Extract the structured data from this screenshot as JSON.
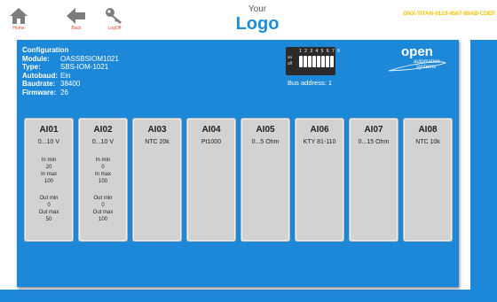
{
  "header": {
    "home_label": "Home",
    "back_label": "Back",
    "logoff_label": "LogOff",
    "logo_small": "Your",
    "logo_big": "Logo",
    "serial": "GNX-TITAN-0123-4567-89AB-CDEF"
  },
  "config": {
    "title": "Configuration",
    "rows": [
      {
        "key": "Module:",
        "value": "OASSBSIOM1021"
      },
      {
        "key": "Type:",
        "value": "SBS-IOM-1021"
      },
      {
        "key": "Autobaud:",
        "value": "Ein"
      },
      {
        "key": "Baudrate:",
        "value": "38400"
      },
      {
        "key": "Firmware:",
        "value": "26"
      }
    ]
  },
  "dip": {
    "on_label": "on",
    "off_label": "off",
    "numbers": "1 2 3 4 5 6 7 8"
  },
  "bus_address": "Bus address: 1",
  "brand": {
    "name": "open",
    "line1": "automation",
    "line2": "systems"
  },
  "channels": [
    {
      "name": "AI01",
      "range": "0...10 V",
      "in_min_label": "In min",
      "in_min": "20",
      "in_max_label": "In max",
      "in_max": "100",
      "out_min_label": "Out min",
      "out_min": "0",
      "out_max_label": "Out max",
      "out_max": "50"
    },
    {
      "name": "AI02",
      "range": "0...10 V",
      "in_min_label": "In min",
      "in_min": "0",
      "in_max_label": "In max",
      "in_max": "100",
      "out_min_label": "Out min",
      "out_min": "0",
      "out_max_label": "Out max",
      "out_max": "100"
    },
    {
      "name": "AI03",
      "range": "NTC 20k"
    },
    {
      "name": "AI04",
      "range": "Pt1000"
    },
    {
      "name": "AI05",
      "range": "0...5 Ohm"
    },
    {
      "name": "AI06",
      "range": "KTY 81-110"
    },
    {
      "name": "AI07",
      "range": "0...15 Ohm"
    },
    {
      "name": "AI08",
      "range": "NTC 10k"
    }
  ],
  "colors": {
    "panel": "#1e88d8",
    "card": "#d2d2d2",
    "nav_label": "#e34a2c",
    "serial": "#f2c200",
    "logo": "#1e8fd6"
  },
  "icons": {
    "home": "home-icon",
    "back": "arrow-left-icon",
    "logoff": "key-icon"
  }
}
